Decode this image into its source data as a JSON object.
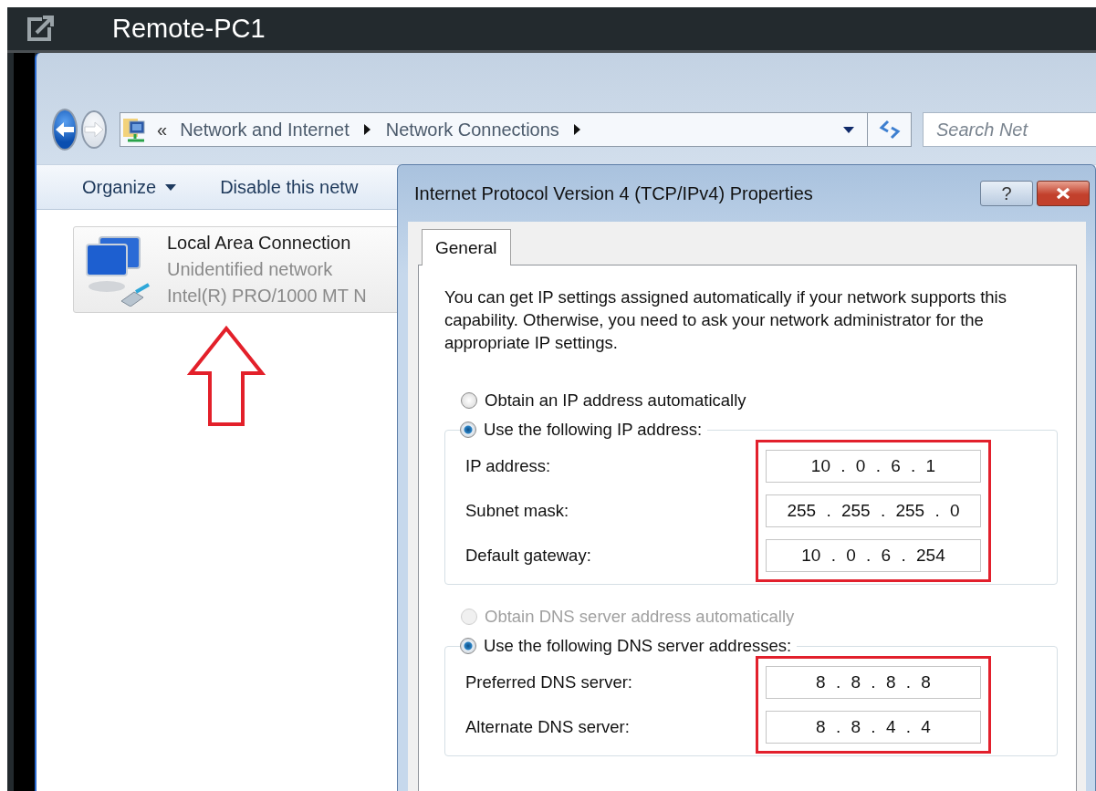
{
  "remote_window": {
    "title": "Remote-PC1"
  },
  "explorer": {
    "back": {
      "disabled": false
    },
    "forward": {
      "disabled": true
    },
    "address_bar": {
      "overflow_mark": "«",
      "crumbs": [
        "Network and Internet",
        "Network Connections"
      ]
    },
    "search": {
      "placeholder": "Search Net"
    },
    "toolbar": [
      {
        "label": "Organize",
        "kind": "menu"
      },
      {
        "label": "Disable this netw",
        "kind": "button"
      }
    ],
    "connections": [
      {
        "name": "Local Area Connection",
        "status": "Unidentified network",
        "device": "Intel(R) PRO/1000 MT N",
        "selected": true,
        "marked_by_arrow": true
      }
    ]
  },
  "dialog": {
    "title": "Internet Protocol Version 4 (TCP/IPv4) Properties",
    "help": "?",
    "tabs": [
      {
        "label": "General",
        "selected": true
      }
    ],
    "description": "You can get IP settings assigned automatically if your network supports this capability. Otherwise, you need to ask your network administrator for the appropriate IP settings.",
    "sections": [
      {
        "auto_option": {
          "label": "Obtain an IP address automatically",
          "selected": false,
          "disabled": false
        },
        "manual_option": {
          "label": "Use the following IP address:",
          "selected": true,
          "disabled": false
        },
        "highlighted": true,
        "fields": [
          {
            "label": "IP address:",
            "value": "10 . 0 . 6 . 1"
          },
          {
            "label": "Subnet mask:",
            "value": "255 . 255 . 255 . 0"
          },
          {
            "label": "Default gateway:",
            "value": "10 . 0 . 6 . 254"
          }
        ]
      },
      {
        "auto_option": {
          "label": "Obtain DNS server address automatically",
          "selected": false,
          "disabled": true
        },
        "manual_option": {
          "label": "Use the following DNS server addresses:",
          "selected": true,
          "disabled": false
        },
        "highlighted": true,
        "fields": [
          {
            "label": "Preferred DNS server:",
            "value": "8 . 8 . 8 . 8"
          },
          {
            "label": "Alternate DNS server:",
            "value": "8 . 8 . 4 . 4"
          }
        ]
      }
    ]
  }
}
